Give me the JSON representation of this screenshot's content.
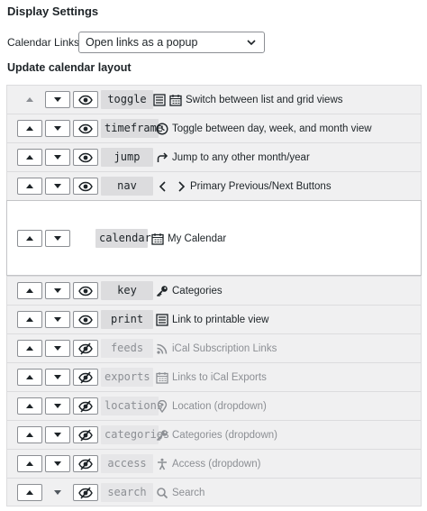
{
  "display_settings_title": "Display Settings",
  "calendar_links": {
    "label": "Calendar Links",
    "value": "Open links as a popup"
  },
  "layout_title": "Update calendar layout",
  "rows": [
    {
      "code": "toggle",
      "desc": "Switch between list and grid views",
      "icons": [
        "list-icon",
        "calendar-icon"
      ],
      "visible": true
    },
    {
      "code": "timeframe",
      "desc": "Toggle between day, week, and month view",
      "icons": [
        "clock-icon"
      ],
      "visible": true
    },
    {
      "code": "jump",
      "desc": "Jump to any other month/year",
      "icons": [
        "redo-arrow-icon"
      ],
      "visible": true
    },
    {
      "code": "nav",
      "desc": "Primary Previous/Next Buttons",
      "icons": [
        "chevron-left-icon",
        "chevron-right-icon"
      ],
      "visible": true
    },
    {
      "code": "calendar",
      "desc": "My Calendar",
      "icons": [
        "calendar-icon"
      ],
      "visible": true
    },
    {
      "code": "key",
      "desc": "Categories",
      "icons": [
        "key-icon"
      ],
      "visible": true
    },
    {
      "code": "print",
      "desc": "Link to printable view",
      "icons": [
        "list-icon"
      ],
      "visible": true
    },
    {
      "code": "feeds",
      "desc": "iCal Subscription Links",
      "icons": [
        "rss-icon"
      ],
      "visible": false
    },
    {
      "code": "exports",
      "desc": "Links to iCal Exports",
      "icons": [
        "calendar-icon"
      ],
      "visible": false
    },
    {
      "code": "locations",
      "desc": "Location (dropdown)",
      "icons": [
        "location-pin-icon"
      ],
      "visible": false
    },
    {
      "code": "categories",
      "desc": "Categories (dropdown)",
      "icons": [
        "key-icon"
      ],
      "visible": false
    },
    {
      "code": "access",
      "desc": "Access (dropdown)",
      "icons": [
        "accessibility-icon"
      ],
      "visible": false
    },
    {
      "code": "search",
      "desc": "Search",
      "icons": [
        "search-icon"
      ],
      "visible": false
    }
  ],
  "colors": {
    "text": "#1d2327",
    "muted": "#8c8f94",
    "row_bg": "#f0f0f1",
    "border": "#dcdcde"
  }
}
